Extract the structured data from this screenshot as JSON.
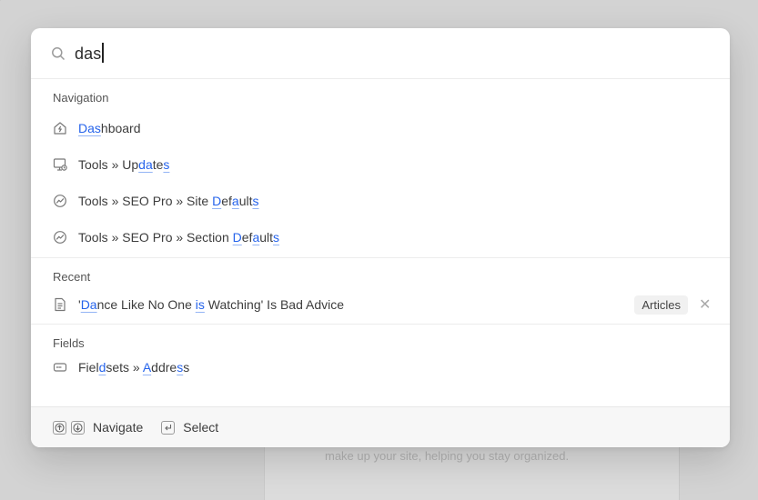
{
  "background": {
    "text": "make up your site, helping you stay organized."
  },
  "search": {
    "query": "das",
    "icon": "search-icon"
  },
  "sections": {
    "navigation": {
      "title": "Navigation",
      "items": [
        {
          "icon": "dashboard-icon",
          "segments": [
            {
              "t": "Das",
              "h": true
            },
            {
              "t": "hboard",
              "h": false
            }
          ]
        },
        {
          "icon": "monitor-icon",
          "segments": [
            {
              "t": "Tools » Up",
              "h": false
            },
            {
              "t": "da",
              "h": true
            },
            {
              "t": "te",
              "h": false
            },
            {
              "t": "s",
              "h": true
            }
          ]
        },
        {
          "icon": "seo-chart-icon",
          "segments": [
            {
              "t": "Tools » SEO Pro » Site ",
              "h": false
            },
            {
              "t": "D",
              "h": true
            },
            {
              "t": "ef",
              "h": false
            },
            {
              "t": "a",
              "h": true
            },
            {
              "t": "ult",
              "h": false
            },
            {
              "t": "s",
              "h": true
            }
          ]
        },
        {
          "icon": "seo-chart-icon",
          "segments": [
            {
              "t": "Tools » SEO Pro » Section ",
              "h": false
            },
            {
              "t": "D",
              "h": true
            },
            {
              "t": "ef",
              "h": false
            },
            {
              "t": "a",
              "h": true
            },
            {
              "t": "ult",
              "h": false
            },
            {
              "t": "s",
              "h": true
            }
          ]
        }
      ]
    },
    "recent": {
      "title": "Recent",
      "items": [
        {
          "icon": "document-icon",
          "segments": [
            {
              "t": "'",
              "h": false
            },
            {
              "t": "Da",
              "h": true
            },
            {
              "t": "nce Like No One ",
              "h": false
            },
            {
              "t": "i",
              "h": true
            },
            {
              "t": "s",
              "h": true
            },
            {
              "t": " Watching' Is Bad Advice",
              "h": false
            }
          ],
          "tag": "Articles",
          "remove": "✕"
        }
      ]
    },
    "fields": {
      "title": "Fields",
      "items": [
        {
          "icon": "field-icon",
          "segments": [
            {
              "t": "Fiel",
              "h": false
            },
            {
              "t": "d",
              "h": true
            },
            {
              "t": "sets » ",
              "h": false
            },
            {
              "t": "A",
              "h": true
            },
            {
              "t": "ddre",
              "h": false
            },
            {
              "t": "s",
              "h": true
            },
            {
              "t": "s",
              "h": false
            }
          ]
        }
      ]
    }
  },
  "footer": {
    "navigate_label": "Navigate",
    "select_label": "Select"
  },
  "colors": {
    "highlight": "#2563eb",
    "background": "#d3d3d3"
  }
}
